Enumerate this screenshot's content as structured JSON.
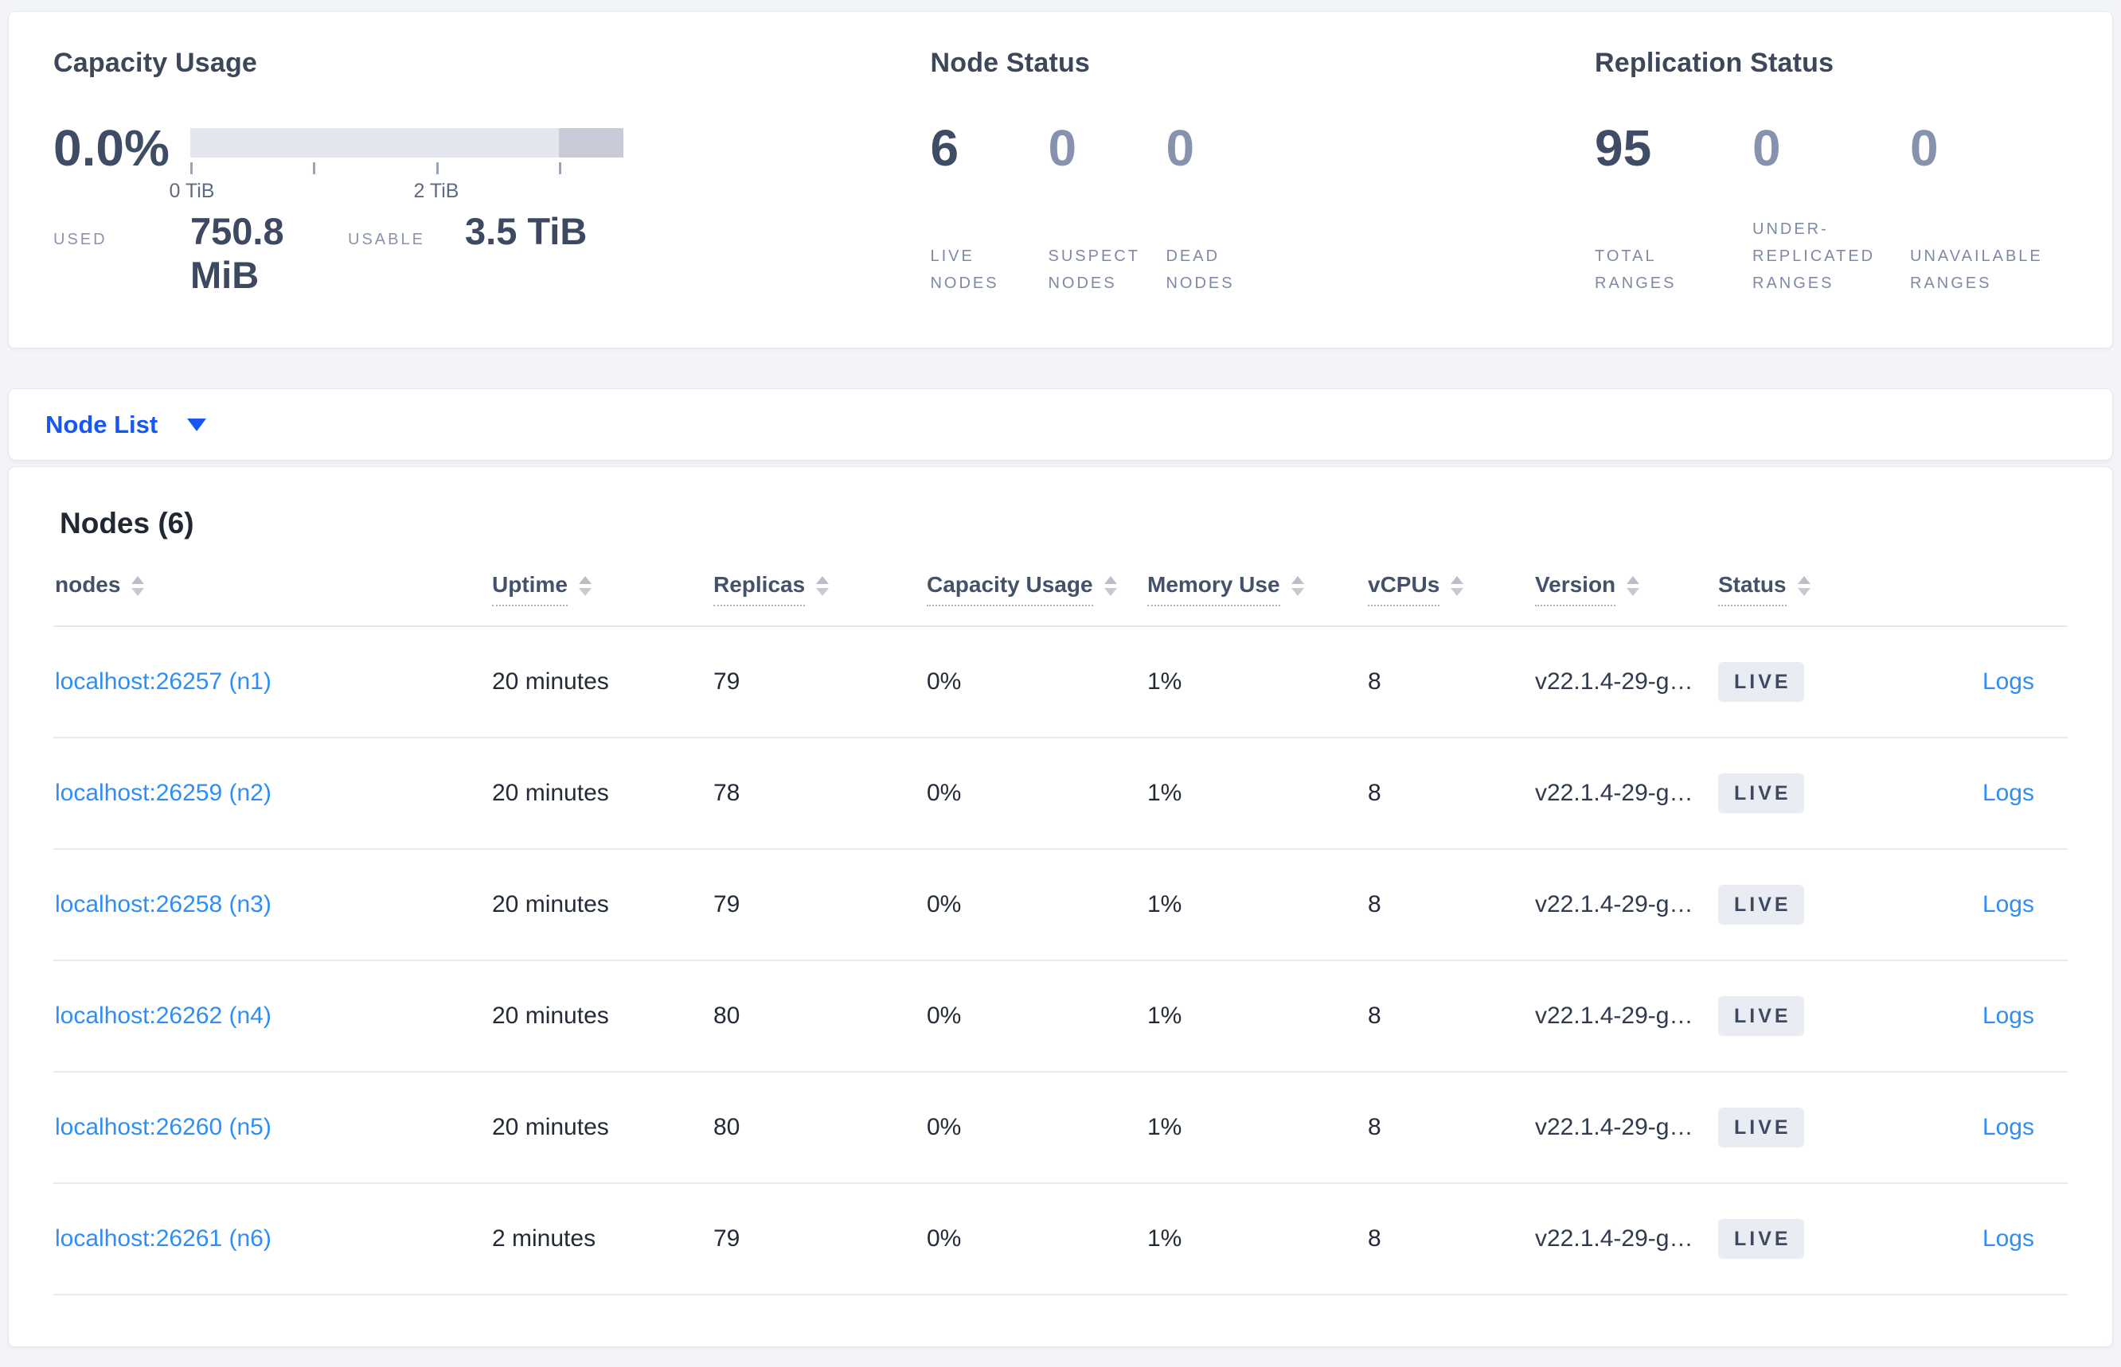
{
  "colors": {
    "accent_blue": "#1557f0",
    "link_blue": "#2f8ef5",
    "badge_bg": "#e9ecf2",
    "badge_text": "#3d4a61",
    "gauge_light": "#e4e6ef",
    "gauge_dark": "#c9ccd8",
    "page_bg": "#f2f4f8"
  },
  "capacity": {
    "title": "Capacity Usage",
    "percent": "0.0%",
    "axis_ticks": [
      {
        "label": "0 TiB"
      },
      {
        "label": ""
      },
      {
        "label": "2 TiB"
      },
      {
        "label": ""
      }
    ],
    "used_label": "USED",
    "used_value": "750.8 MiB",
    "usable_label": "USABLE",
    "usable_value": "3.5 TiB"
  },
  "node_status": {
    "title": "Node Status",
    "stats": [
      {
        "value": "6",
        "label": "LIVE NODES"
      },
      {
        "value": "0",
        "label": "SUSPECT NODES"
      },
      {
        "value": "0",
        "label": "DEAD NODES"
      }
    ]
  },
  "replication": {
    "title": "Replication Status",
    "stats": [
      {
        "value": "95",
        "label": "TOTAL RANGES"
      },
      {
        "value": "0",
        "label": "UNDER-REPLICATED RANGES"
      },
      {
        "value": "0",
        "label": "UNAVAILABLE RANGES"
      }
    ]
  },
  "node_list": {
    "label": "Node List"
  },
  "table": {
    "title": "Nodes (6)",
    "logs_label": "Logs",
    "columns": [
      {
        "label": "nodes"
      },
      {
        "label": "Uptime"
      },
      {
        "label": "Replicas"
      },
      {
        "label": "Capacity Usage"
      },
      {
        "label": "Memory Use"
      },
      {
        "label": "vCPUs"
      },
      {
        "label": "Version"
      },
      {
        "label": "Status"
      }
    ],
    "rows": [
      {
        "node": "localhost:26257 (n1)",
        "uptime": "20 minutes",
        "replicas": "79",
        "capacity": "0%",
        "memory": "1%",
        "vcpus": "8",
        "version": "v22.1.4-29-g…",
        "status": "LIVE"
      },
      {
        "node": "localhost:26259 (n2)",
        "uptime": "20 minutes",
        "replicas": "78",
        "capacity": "0%",
        "memory": "1%",
        "vcpus": "8",
        "version": "v22.1.4-29-g…",
        "status": "LIVE"
      },
      {
        "node": "localhost:26258 (n3)",
        "uptime": "20 minutes",
        "replicas": "79",
        "capacity": "0%",
        "memory": "1%",
        "vcpus": "8",
        "version": "v22.1.4-29-g…",
        "status": "LIVE"
      },
      {
        "node": "localhost:26262 (n4)",
        "uptime": "20 minutes",
        "replicas": "80",
        "capacity": "0%",
        "memory": "1%",
        "vcpus": "8",
        "version": "v22.1.4-29-g…",
        "status": "LIVE"
      },
      {
        "node": "localhost:26260 (n5)",
        "uptime": "20 minutes",
        "replicas": "80",
        "capacity": "0%",
        "memory": "1%",
        "vcpus": "8",
        "version": "v22.1.4-29-g…",
        "status": "LIVE"
      },
      {
        "node": "localhost:26261 (n6)",
        "uptime": "2 minutes",
        "replicas": "79",
        "capacity": "0%",
        "memory": "1%",
        "vcpus": "8",
        "version": "v22.1.4-29-g…",
        "status": "LIVE"
      }
    ]
  }
}
